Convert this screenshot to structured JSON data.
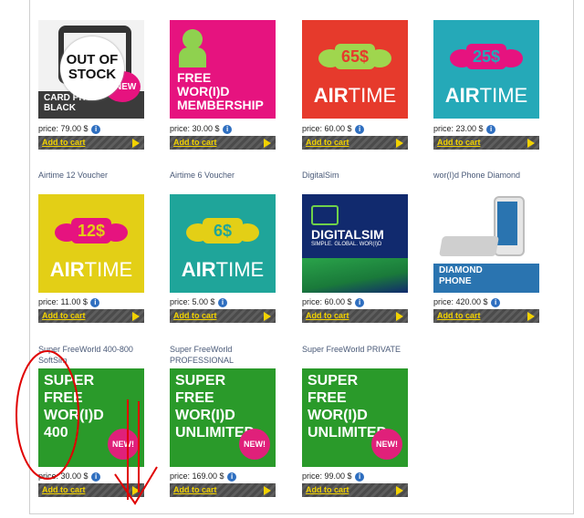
{
  "cart_label": "Add to cart",
  "info_icon": "i",
  "colors": {
    "cart_text": "#f2d200",
    "pink": "#e6137f",
    "red_airtime": "#e63a2c",
    "teal_airtime": "#25a9b8",
    "yellow_airtime": "#e3cf16",
    "green_airtime": "#1fa59a",
    "navy_digital": "#112a6e",
    "green_super": "#2a9a2a",
    "annotation_red": "#e00000"
  },
  "rows": [
    {
      "items": [
        {
          "name": "",
          "price": "price: 79.00 $",
          "tile_texts": [
            "OUT OF",
            "STOCK",
            "CARD PHO",
            "BLACK",
            "NEW"
          ]
        },
        {
          "name": "",
          "price": "price: 30.00 $",
          "tile_texts": [
            "FREE",
            "WOR(I)D",
            "MEMBERSHIP"
          ]
        },
        {
          "name": "",
          "price": "price: 60.00 $",
          "tile_texts": [
            "65$",
            "AIR",
            "TIME"
          ]
        },
        {
          "name": "",
          "price": "price: 23.00 $",
          "tile_texts": [
            "25$",
            "AIR",
            "TIME"
          ]
        }
      ]
    },
    {
      "items": [
        {
          "name": "Airtime 12 Voucher",
          "price": "price: 11.00 $",
          "tile_texts": [
            "12$",
            "AIR",
            "TIME"
          ]
        },
        {
          "name": "Airtime 6 Voucher",
          "price": "price: 5.00 $",
          "tile_texts": [
            "6$",
            "AIR",
            "TIME"
          ]
        },
        {
          "name": "DigitalSim",
          "price": "price: 60.00 $",
          "tile_texts": [
            "DIGITALSIM",
            "SIMPLE. GLOBAL. WOR(I)D"
          ]
        },
        {
          "name": "wor(I)d Phone Diamond",
          "price": "price: 420.00 $",
          "tile_texts": [
            "DIAMOND",
            "PHONE"
          ]
        }
      ]
    },
    {
      "items": [
        {
          "name": "Super FreeWorld 400-800 SoftSim",
          "price": "price: 30.00 $",
          "tile_texts": [
            "SUPER",
            "FREE",
            "WOR(I)D",
            "400",
            "NEW!"
          ]
        },
        {
          "name": "Super FreeWorld PROFESSIONAL",
          "price": "price: 169.00 $",
          "tile_texts": [
            "SUPER",
            "FREE",
            "WOR(I)D",
            "UNLIMITED",
            "NEW!"
          ]
        },
        {
          "name": "Super FreeWorld PRIVATE",
          "price": "price: 99.00 $",
          "tile_texts": [
            "SUPER",
            "FREE",
            "WOR(I)D",
            "UNLIMITED",
            "NEW!"
          ]
        }
      ]
    }
  ]
}
